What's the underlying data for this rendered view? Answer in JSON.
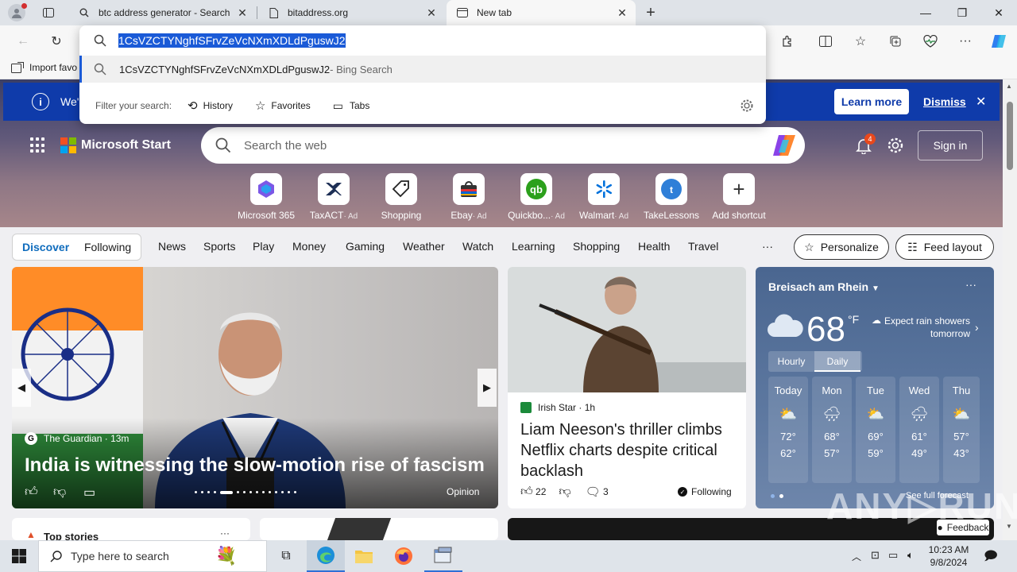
{
  "tabs": [
    {
      "title": "btc address generator - Search",
      "icon": "search-icon"
    },
    {
      "title": "bitaddress.org",
      "icon": "page-icon"
    },
    {
      "title": "New tab",
      "icon": "newtab-icon",
      "active": true
    }
  ],
  "omnibox": {
    "value": "1CsVZCTYNghfSFrvZeVcNXmXDLdPguswJ2",
    "suggestion_text": "1CsVZCTYNghfSFrvZeVcNXmXDLdPguswJ2",
    "suggestion_source": " - Bing Search",
    "filter_label": "Filter your search:",
    "filters": [
      "History",
      "Favorites",
      "Tabs"
    ]
  },
  "favbar": {
    "import_label": "Import favo"
  },
  "notice": {
    "text": "We'",
    "learn_more": "Learn more",
    "dismiss": "Dismiss"
  },
  "header": {
    "brand": "Microsoft Start",
    "search_placeholder": "Search the web",
    "notification_count": "4",
    "sign_in": "Sign in"
  },
  "shortcuts": [
    {
      "label": "Microsoft 365",
      "ad": ""
    },
    {
      "label": "TaxACT",
      "ad": "· Ad"
    },
    {
      "label": "Shopping",
      "ad": ""
    },
    {
      "label": "Ebay",
      "ad": "· Ad"
    },
    {
      "label": "Quickbo...",
      "ad": "· Ad"
    },
    {
      "label": "Walmart",
      "ad": "· Ad"
    },
    {
      "label": "TakeLessons",
      "ad": ""
    },
    {
      "label": "Add shortcut",
      "ad": ""
    }
  ],
  "nav": {
    "discover": "Discover",
    "following": "Following",
    "items": [
      "News",
      "Sports",
      "Play",
      "Money",
      "Gaming",
      "Weather",
      "Watch",
      "Learning",
      "Shopping",
      "Health",
      "Travel"
    ],
    "more": "···",
    "personalize": "Personalize",
    "feed_layout": "Feed layout"
  },
  "main_story": {
    "source": "The Guardian",
    "time": "· 13m",
    "headline": "India is witnessing the slow-motion rise of fascism",
    "tag": "Opinion"
  },
  "side_story": {
    "source": "Irish Star",
    "time": "· 1h",
    "headline": "Liam Neeson's thriller climbs Netflix charts despite critical backlash",
    "likes": "22",
    "comments": "3",
    "following": "Following"
  },
  "weather": {
    "location": "Breisach am Rhein",
    "temp": "68",
    "unit": "°F",
    "outlook": "Expect rain showers tomorrow",
    "tabs": [
      "Hourly",
      "Daily"
    ],
    "days": [
      {
        "day": "Today",
        "high": "72°",
        "low": "62°"
      },
      {
        "day": "Mon",
        "high": "68°",
        "low": "57°"
      },
      {
        "day": "Tue",
        "high": "69°",
        "low": "59°"
      },
      {
        "day": "Wed",
        "high": "61°",
        "low": "49°"
      },
      {
        "day": "Thu",
        "high": "57°",
        "low": "43°"
      }
    ],
    "full_forecast": "See full forecast"
  },
  "bottom": {
    "top_stories": "Top stories",
    "feedback": "Feedback"
  },
  "taskbar": {
    "search_placeholder": "Type here to search",
    "time": "10:23 AM",
    "date": "9/8/2024"
  }
}
